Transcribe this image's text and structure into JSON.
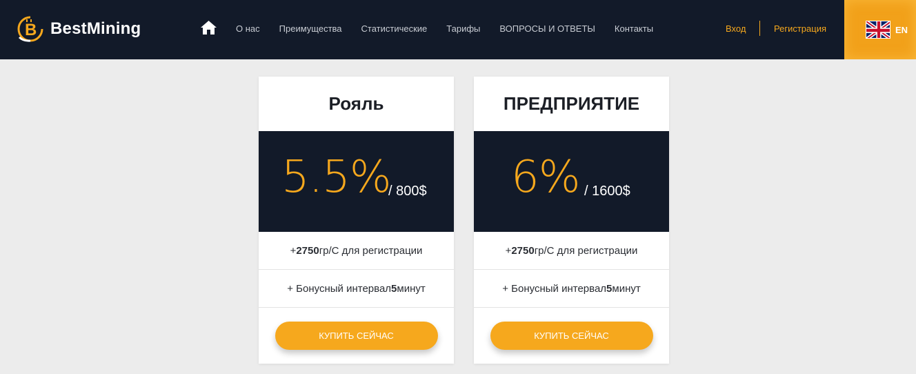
{
  "brand": {
    "name": "BestMining",
    "logo_icon": "bitcoin-b-icon"
  },
  "nav": {
    "home_icon": "home-icon",
    "items": [
      {
        "label": "О нас"
      },
      {
        "label": "Преимущества"
      },
      {
        "label": "Статистические"
      },
      {
        "label": "Тарифы"
      },
      {
        "label": "ВОПРОСЫ И ОТВЕТЫ"
      },
      {
        "label": "Контакты"
      }
    ]
  },
  "auth": {
    "login": "Вход",
    "register": "Регистрация"
  },
  "language": {
    "code": "EN",
    "flag_icon": "uk-flag-icon"
  },
  "colors": {
    "nav_bg": "#121a29",
    "accent": "#f6a81d",
    "page_bg": "#ececec"
  },
  "plans": [
    {
      "title": "Рояль",
      "percent": "5.5%",
      "price": "/ 800$",
      "feature1": {
        "prefix": "+ ",
        "value": "2750",
        "suffix": " гр/С для регистрации"
      },
      "feature2": {
        "prefix": "+ Бонусный интервал ",
        "value": "5",
        "suffix": " минут"
      },
      "button": "КУПИТЬ СЕЙЧАС"
    },
    {
      "title": "ПРЕДПРИЯТИЕ",
      "percent": "6%",
      "price": "/ 1600$",
      "feature1": {
        "prefix": "+ ",
        "value": "2750",
        "suffix": " гр/С для регистрации"
      },
      "feature2": {
        "prefix": "+ Бонусный интервал ",
        "value": "5",
        "suffix": " минут"
      },
      "button": "КУПИТЬ СЕЙЧАС"
    }
  ]
}
